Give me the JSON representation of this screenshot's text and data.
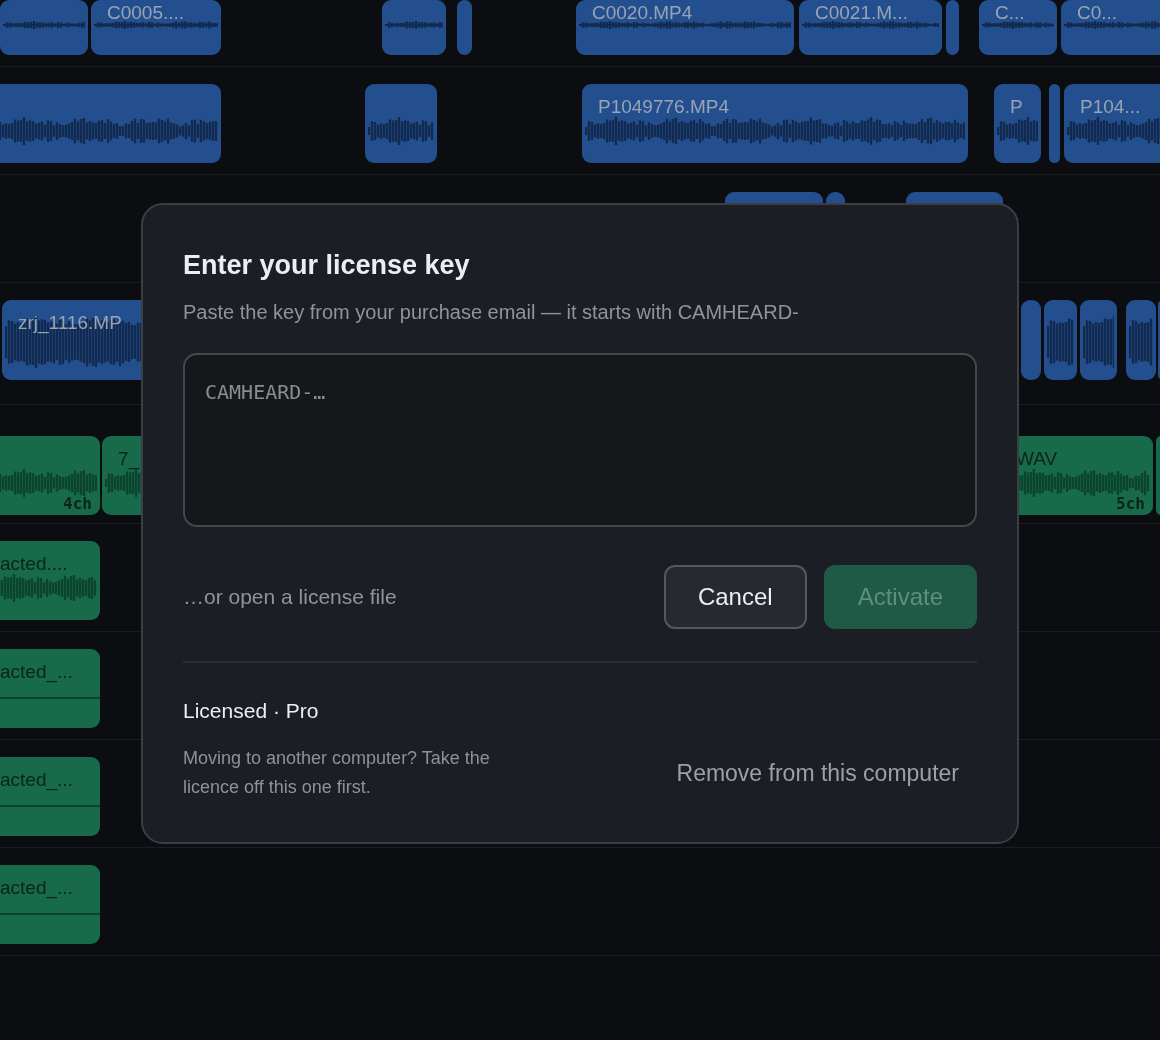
{
  "tracks": [
    {
      "kind": "video",
      "clips": [
        {
          "label": "C0005...."
        },
        {
          "label": "C0020.MP4"
        },
        {
          "label": "C0021.M..."
        },
        {
          "label": "C..."
        },
        {
          "label": "C0..."
        }
      ]
    },
    {
      "kind": "video",
      "clips": [
        {
          "label": "P1049776.MP4"
        },
        {
          "label": "P"
        },
        {
          "label": "P104..."
        }
      ]
    },
    {
      "kind": "video"
    },
    {
      "kind": "video",
      "clips": [
        {
          "label": "zrj_1116.MP"
        }
      ]
    },
    {
      "kind": "audio",
      "clips": [
        {
          "channels": "4ch"
        },
        {
          "label": "7_"
        },
        {
          "label": "WAV",
          "channels": "5ch"
        }
      ]
    },
    {
      "kind": "audio",
      "clips": [
        {
          "label": "acted...."
        }
      ]
    },
    {
      "kind": "audio",
      "clips": [
        {
          "label": "acted_..."
        }
      ]
    },
    {
      "kind": "audio",
      "clips": [
        {
          "label": "acted_..."
        }
      ]
    },
    {
      "kind": "audio",
      "clips": [
        {
          "label": "acted_..."
        }
      ]
    }
  ],
  "dialog": {
    "title": "Enter your license key",
    "subtitle": "Paste the key from your purchase email — it starts with CAMHEARD-",
    "key_field": {
      "placeholder": "CAMHEARD-…"
    },
    "open_file_link": "…or open a license file",
    "buttons": [
      {
        "label": "Cancel",
        "kind": "secondary",
        "disabled": false
      },
      {
        "label": "Activate",
        "kind": "primary",
        "disabled": true
      }
    ],
    "license": {
      "status": "Licensed · Pro",
      "note": "Moving to another computer? Take the licence off this one first.",
      "remove_link": "Remove from this computer"
    }
  }
}
